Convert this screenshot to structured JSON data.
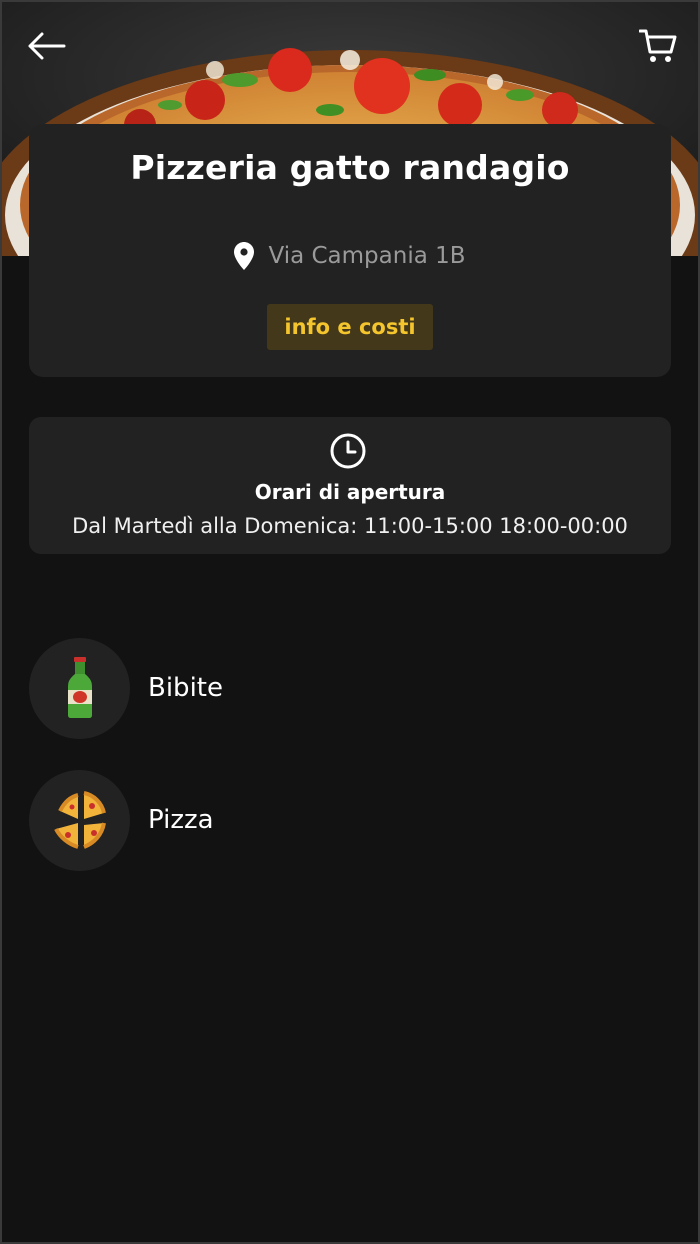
{
  "header": {
    "back_icon": "arrow-left-icon",
    "cart_icon": "cart-icon",
    "hero_image": "pizza-photo"
  },
  "restaurant": {
    "name": "Pizzeria gatto randagio",
    "address": "Via Campania 1B",
    "address_icon": "location-pin-icon",
    "info_button_label": "info e costi"
  },
  "hours": {
    "icon": "clock-icon",
    "title": "Orari di apertura",
    "text": "Dal Martedì alla Domenica: 11:00-15:00 18:00-00:00"
  },
  "categories": [
    {
      "label": "Bibite",
      "icon": "bottle-icon"
    },
    {
      "label": "Pizza",
      "icon": "pizza-slices-icon"
    }
  ],
  "colors": {
    "background": "#121212",
    "card": "#222222",
    "accent": "#f4c52d",
    "accent_bg": "#43381a",
    "muted_text": "#9a9a9a"
  }
}
